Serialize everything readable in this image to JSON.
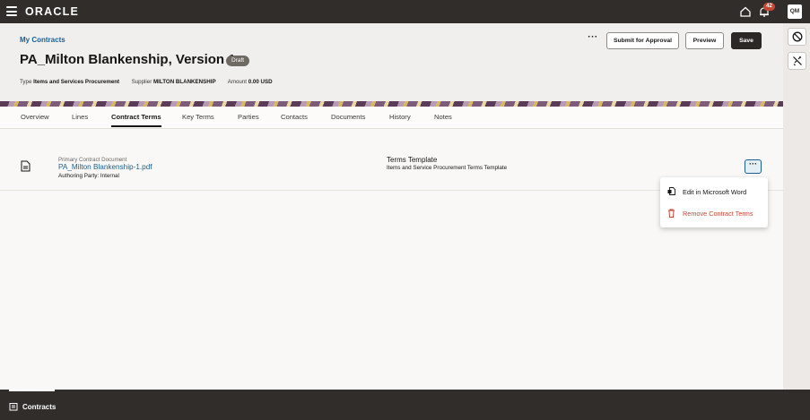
{
  "topbar": {
    "brand": "ORACLE",
    "notification_count": "42",
    "user_initials": "QM",
    "icons": [
      "menu-icon",
      "home-icon",
      "bell-icon"
    ]
  },
  "header": {
    "breadcrumb": "My Contracts",
    "title": "PA_Milton Blankenship, Version 1",
    "status": "Draft",
    "meta": {
      "type_label": "Type",
      "type_value": "Items and Services Procurement",
      "supplier_label": "Supplier",
      "supplier_value": "MILTON BLANKENSHIP",
      "amount_label": "Amount",
      "amount_value": "0.00 USD"
    },
    "actions": {
      "more_label": "···",
      "submit_label": "Submit for Approval",
      "preview_label": "Preview",
      "save_label": "Save"
    }
  },
  "tabs": [
    {
      "label": "Overview",
      "active": false
    },
    {
      "label": "Lines",
      "active": false
    },
    {
      "label": "Contract Terms",
      "active": true
    },
    {
      "label": "Key Terms",
      "active": false
    },
    {
      "label": "Parties",
      "active": false
    },
    {
      "label": "Contacts",
      "active": false
    },
    {
      "label": "Documents",
      "active": false
    },
    {
      "label": "History",
      "active": false
    },
    {
      "label": "Notes",
      "active": false
    }
  ],
  "content": {
    "doc_caption": "Primary Contract Document",
    "doc_link": "PA_Milton Blankenship-1.pdf",
    "authoring_party": "Authoring Party: Internal",
    "terms_label": "Terms Template",
    "terms_value": "Items and Service Procurement Terms Template",
    "row_more_label": "···"
  },
  "menu": {
    "items": [
      {
        "label": "Edit in Microsoft Word",
        "icon": "word-doc-icon"
      },
      {
        "label": "Remove Contract Terms",
        "icon": "trash-icon"
      }
    ]
  },
  "rail": {
    "icons": [
      "blocked-icon",
      "unlink-icon"
    ]
  },
  "bottombar": {
    "tab_label": "Contracts"
  },
  "colors": {
    "topbar_bg": "#312d2a",
    "link": "#1c5e8e",
    "danger": "#c74634",
    "save_bg": "#2b2826"
  }
}
